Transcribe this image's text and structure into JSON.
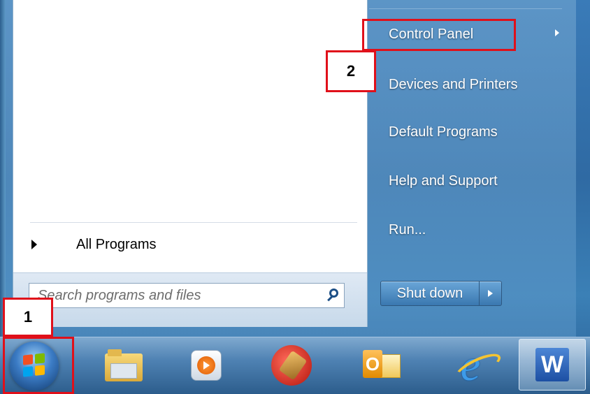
{
  "start_menu": {
    "all_programs_label": "All Programs",
    "search_placeholder": "Search programs and files",
    "right_items": [
      {
        "label": "Control Panel",
        "has_submenu": true
      },
      {
        "label": "Devices and Printers"
      },
      {
        "label": "Default Programs"
      },
      {
        "label": "Help and Support"
      },
      {
        "label": "Run..."
      }
    ],
    "shutdown_label": "Shut down"
  },
  "taskbar": {
    "icons": [
      "windows-start-orb",
      "windows-explorer-icon",
      "media-player-icon",
      "ccleaner-icon",
      "outlook-icon",
      "internet-explorer-icon",
      "word-icon"
    ],
    "word_letter": "W",
    "outlook_letter": "O"
  },
  "annotations": [
    {
      "number": "1",
      "target": "start-button"
    },
    {
      "number": "2",
      "target": "control-panel"
    }
  ],
  "colors": {
    "annotation": "#e0101a",
    "menu_text": "#ffffff"
  }
}
